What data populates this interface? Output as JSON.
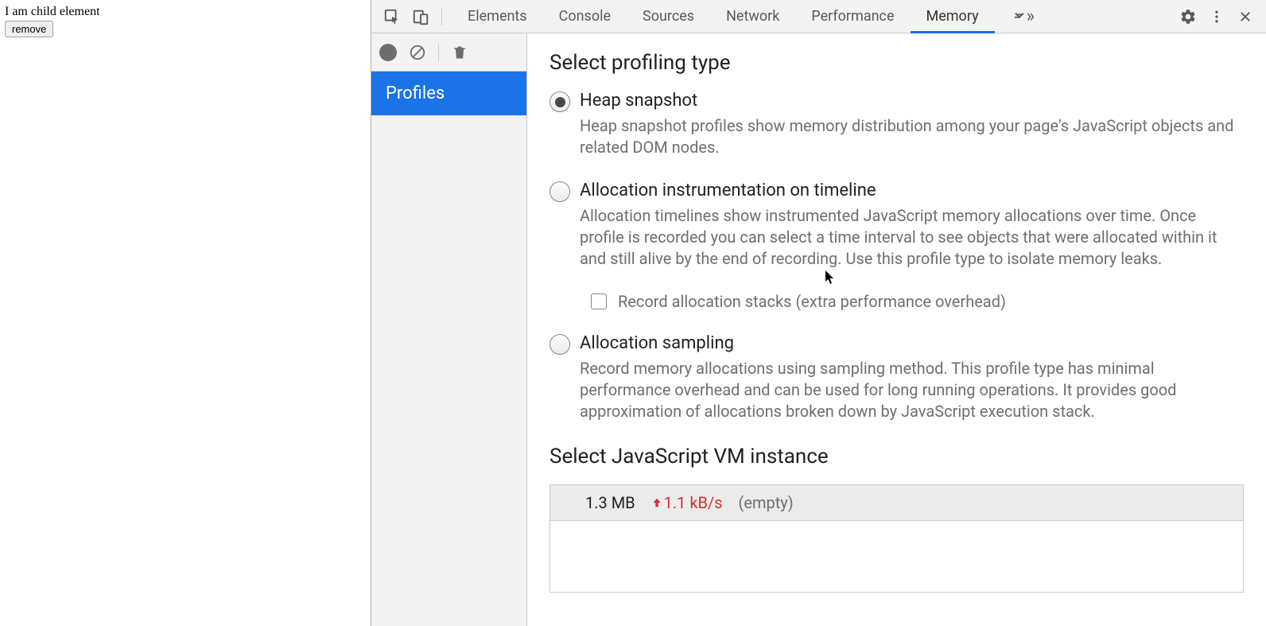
{
  "page": {
    "child_text": "I am child element",
    "remove_btn": "remove"
  },
  "tabbar": {
    "tabs": [
      "Elements",
      "Console",
      "Sources",
      "Network",
      "Performance",
      "Memory"
    ],
    "active_index": 5
  },
  "sidebar": {
    "profiles_label": "Profiles"
  },
  "main": {
    "heading": "Select profiling type",
    "options": [
      {
        "title": "Heap snapshot",
        "desc": "Heap snapshot profiles show memory distribution among your page's JavaScript objects and related DOM nodes.",
        "selected": true
      },
      {
        "title": "Allocation instrumentation on timeline",
        "desc": "Allocation timelines show instrumented JavaScript memory allocations over time. Once profile is recorded you can select a time interval to see objects that were allocated within it and still alive by the end of recording. Use this profile type to isolate memory leaks.",
        "selected": false,
        "sub_option": "Record allocation stacks (extra performance overhead)"
      },
      {
        "title": "Allocation sampling",
        "desc": "Record memory allocations using sampling method. This profile type has minimal performance overhead and can be used for long running operations. It provides good approximation of allocations broken down by JavaScript execution stack.",
        "selected": false
      }
    ],
    "vm_heading": "Select JavaScript VM instance",
    "vm_instance": {
      "size": "1.3 MB",
      "rate": "1.1 kB/s",
      "label": "(empty)"
    }
  }
}
